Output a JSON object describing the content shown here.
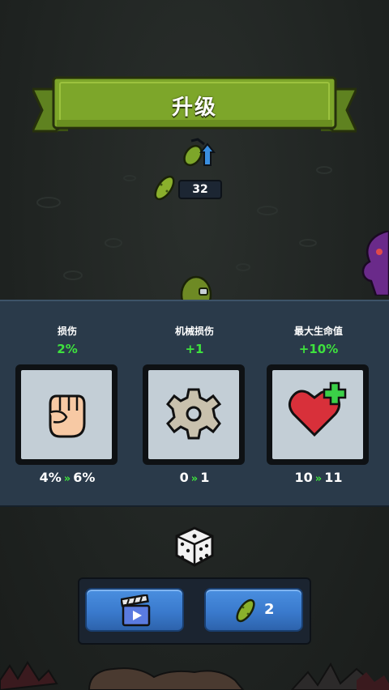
{
  "title": "升级",
  "currency": {
    "icon": "pickle-icon",
    "count": "32"
  },
  "upgrades": [
    {
      "title": "损伤",
      "gain": "2%",
      "icon": "fist-icon",
      "from": "4%",
      "to": "6%"
    },
    {
      "title": "机械损伤",
      "gain": "+1",
      "icon": "gear-icon",
      "from": "0",
      "to": "1"
    },
    {
      "title": "最大生命值",
      "gain": "+10%",
      "icon": "heart-plus-icon",
      "from": "10",
      "to": "11"
    }
  ],
  "arrow_glyph": "»",
  "buttons": {
    "ad": {
      "icon": "video-clapper-icon"
    },
    "buy": {
      "icon": "pickle-icon",
      "cost": "2"
    }
  },
  "colors": {
    "gain": "#3ee23e",
    "banner": "#7da62a",
    "button": "#3a7acd",
    "panel": "#2a3a4a"
  }
}
